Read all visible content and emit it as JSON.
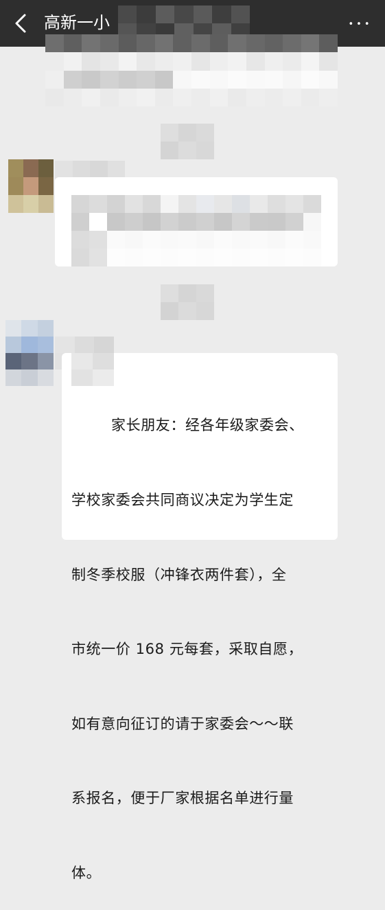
{
  "header": {
    "title": "高新一小",
    "back_icon": "chevron-left-icon",
    "more_icon": "more-horizontal-icon",
    "more_glyph": "•••",
    "background": "#2e2e2e"
  },
  "chat": {
    "background": "#ececec",
    "visible_message": {
      "sender": "pixelated",
      "text": "家长朋友：经各年级家委会、学校家委会共同商议决定为学生定制冬季校服（冲锋衣两件套），全市统一价 168 元每套，采取自愿，如有意向征订的请于家委会～～联系报名，便于厂家根据名单进行量体。",
      "text_lines": [
        "家长朋友：经各年级家委会、",
        "学校家委会共同商议决定为学生定",
        "制冬季校服（冲锋衣两件套），全",
        "市统一价 168 元每套，采取自愿，",
        "如有意向征订的请于家委会～～联",
        "系报名，便于厂家根据名单进行量",
        "体。"
      ]
    }
  }
}
